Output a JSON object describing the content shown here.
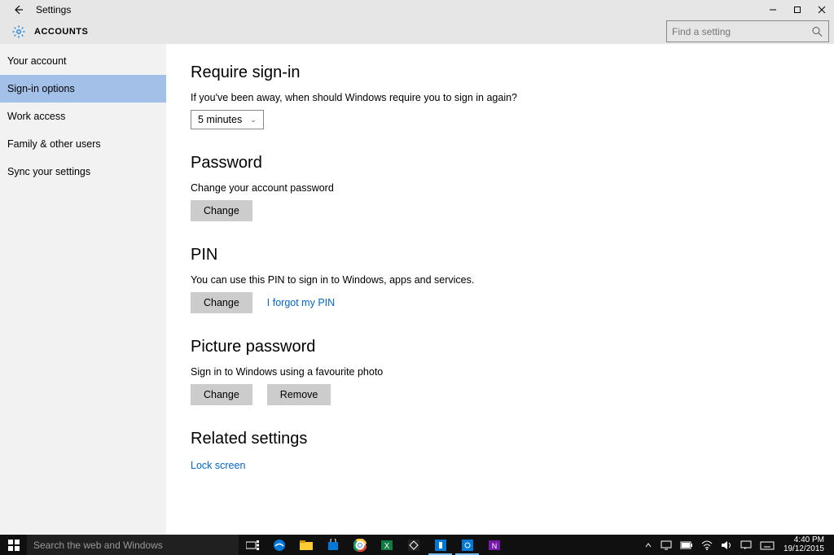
{
  "window": {
    "title": "Settings",
    "section": "ACCOUNTS"
  },
  "search": {
    "placeholder": "Find a setting"
  },
  "sidebar": {
    "items": [
      {
        "label": "Your account",
        "selected": false
      },
      {
        "label": "Sign-in options",
        "selected": true
      },
      {
        "label": "Work access",
        "selected": false
      },
      {
        "label": "Family & other users",
        "selected": false
      },
      {
        "label": "Sync your settings",
        "selected": false
      }
    ]
  },
  "content": {
    "require_signin": {
      "heading": "Require sign-in",
      "desc": "If you've been away, when should Windows require you to sign in again?",
      "dropdown_value": "5 minutes"
    },
    "password": {
      "heading": "Password",
      "desc": "Change your account password",
      "change_btn": "Change"
    },
    "pin": {
      "heading": "PIN",
      "desc": "You can use this PIN to sign in to Windows, apps and services.",
      "change_btn": "Change",
      "forgot_link": "I forgot my PIN"
    },
    "picture_password": {
      "heading": "Picture password",
      "desc": "Sign in to Windows using a favourite photo",
      "change_btn": "Change",
      "remove_btn": "Remove"
    },
    "related": {
      "heading": "Related settings",
      "lock_screen_link": "Lock screen"
    }
  },
  "taskbar": {
    "search_placeholder": "Search the web and Windows",
    "time": "4:40 PM",
    "date": "19/12/2015"
  }
}
